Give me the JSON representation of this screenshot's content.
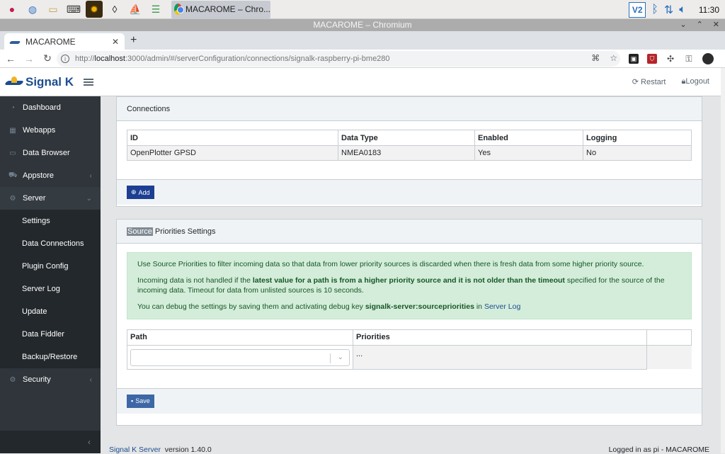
{
  "taskbar": {
    "icons": [
      "raspberry-icon",
      "globe-icon",
      "folder-icon",
      "keyboard-icon",
      "sun-icon",
      "opencpn-icon",
      "signalk-icon",
      "settings-icon"
    ],
    "task_label": "MACAROME – Chro...",
    "clock": "11:30"
  },
  "window": {
    "title": "MACAROME – Chromium"
  },
  "browser": {
    "tab_title": "MACAROME",
    "url_prefix": "http://",
    "url_host": "localhost",
    "url_rest": ":3000/admin/#/serverConfiguration/connections/signalk-raspberry-pi-bme280"
  },
  "app": {
    "brand": "Signal K",
    "restart_label": "Restart",
    "logout_label": "Logout"
  },
  "sidebar": {
    "items": [
      {
        "label": "Dashboard",
        "icon": "speedometer-icon"
      },
      {
        "label": "Webapps",
        "icon": "grid-icon"
      },
      {
        "label": "Data Browser",
        "icon": "folder-icon"
      },
      {
        "label": "Appstore",
        "icon": "basket-icon",
        "caret": "‹"
      },
      {
        "label": "Server",
        "icon": "gear-icon",
        "caret": "⌄"
      }
    ],
    "server_sub": [
      {
        "label": "Settings"
      },
      {
        "label": "Data Connections"
      },
      {
        "label": "Plugin Config"
      },
      {
        "label": "Server Log"
      },
      {
        "label": "Update"
      },
      {
        "label": "Data Fiddler"
      },
      {
        "label": "Backup/Restore"
      }
    ],
    "security": {
      "label": "Security",
      "caret": "‹"
    },
    "collapse": "‹"
  },
  "connections": {
    "header": "Connections",
    "columns": [
      "ID",
      "Data Type",
      "Enabled",
      "Logging"
    ],
    "rows": [
      [
        "OpenPlotter GPSD",
        "NMEA0183",
        "Yes",
        "No"
      ]
    ],
    "add_label": "Add"
  },
  "priorities": {
    "header_highlight": "Source",
    "header_rest": " Priorities Settings",
    "alert_p1": "Use Source Priorities to filter incoming data so that data from lower priority sources is discarded when there is fresh data from some higher priority source.",
    "alert_p2_a": "Incoming data is not handled if the ",
    "alert_p2_b": "latest value for a path is from a higher priority source and it is not older than the timeout",
    "alert_p2_c": " specified for the source of the incoming data. Timeout for data from unlisted sources is 10 seconds.",
    "alert_p3_a": "You can debug the settings by saving them and activating debug key ",
    "alert_p3_b": "signalk-server:sourcepriorities",
    "alert_p3_c": " in ",
    "alert_p3_link": "Server Log",
    "columns": [
      "Path",
      "Priorities",
      ""
    ],
    "priorities_placeholder": "...",
    "save_label": "Save"
  },
  "footer": {
    "link": "Signal K Server",
    "version": "version 1.40.0",
    "logged_in": "Logged in as pi - MACAROME"
  }
}
